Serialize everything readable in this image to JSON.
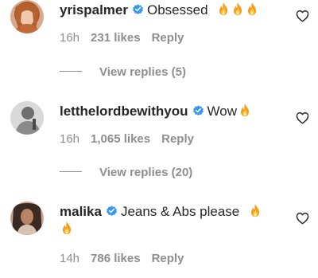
{
  "comments": [
    {
      "username": "yrispalmer",
      "verified": true,
      "text": "Obsessed",
      "emoji": [
        "fire",
        "fire",
        "fire"
      ],
      "time": "16h",
      "likes": "231 likes",
      "reply_label": "Reply",
      "view_replies": "View replies (5)"
    },
    {
      "username": "letthelordbewithyou",
      "verified": true,
      "text": "Wow",
      "emoji": [
        "fire"
      ],
      "time": "16h",
      "likes": "1,065 likes",
      "reply_label": "Reply",
      "view_replies": "View replies (20)"
    },
    {
      "username": "malika",
      "verified": true,
      "text": "Jeans & Abs please",
      "emoji": [
        "fire",
        "fire"
      ],
      "time": "14h",
      "likes": "786 likes",
      "reply_label": "Reply"
    }
  ],
  "icons": {
    "verified": "verified-badge-icon",
    "like": "heart-outline-icon",
    "emoji": "fire-emoji-icon"
  },
  "colors": {
    "verified_blue": "#3897f0",
    "secondary_text": "#8e8e8e",
    "primary_text": "#262626"
  }
}
